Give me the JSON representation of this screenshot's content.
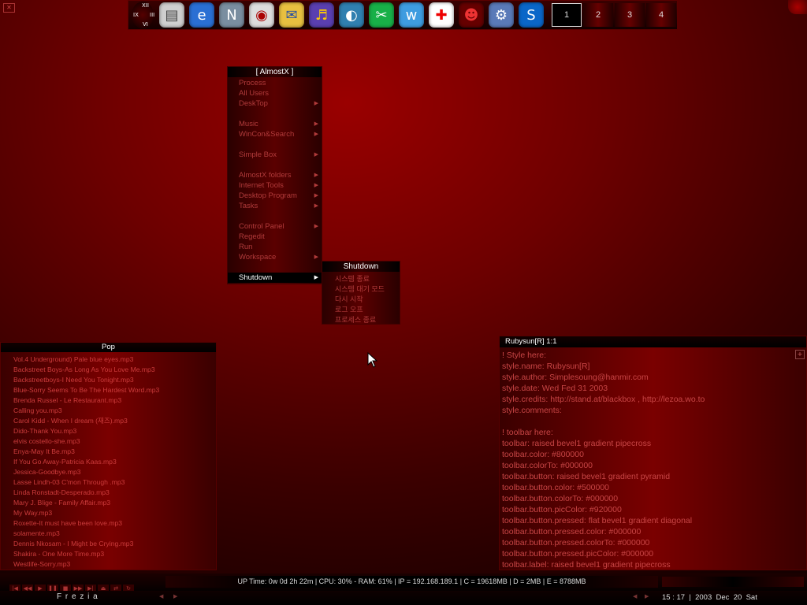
{
  "dock": {
    "clock_numerals": {
      "top": "XII",
      "left": "IX",
      "right": "III",
      "bottom": "VI"
    },
    "icons": [
      {
        "name": "files-icon",
        "glyph": "▤",
        "bg": "#cfcfcf",
        "fg": "#444"
      },
      {
        "name": "internet-explorer-icon",
        "glyph": "e",
        "bg": "#2a6fd3",
        "fg": "#fff"
      },
      {
        "name": "netscape-icon",
        "glyph": "N",
        "bg": "#7a8ea0",
        "fg": "#fff"
      },
      {
        "name": "dvd-icon",
        "glyph": "◉",
        "bg": "#ddd",
        "fg": "#a00"
      },
      {
        "name": "photo-icon",
        "glyph": "✉",
        "bg": "#e8c040",
        "fg": "#2a50a0"
      },
      {
        "name": "media-player-icon",
        "glyph": "♬",
        "bg": "#5a3fb0",
        "fg": "#ffcc00"
      },
      {
        "name": "eye-icon",
        "glyph": "◐",
        "bg": "#3080b0",
        "fg": "#fff"
      },
      {
        "name": "scissors-icon",
        "glyph": "✂",
        "bg": "#18b048",
        "fg": "#fff"
      },
      {
        "name": "word-icon",
        "glyph": "w",
        "bg": "#3e9ce0",
        "fg": "#fff"
      },
      {
        "name": "plus-icon",
        "glyph": "✚",
        "bg": "#fff",
        "fg": "#e00"
      },
      {
        "name": "devil-icon",
        "glyph": "☻",
        "bg": "#600",
        "fg": "#e33"
      },
      {
        "name": "gear-icon",
        "glyph": "⚙",
        "bg": "#5a7ab8",
        "fg": "#fff"
      },
      {
        "name": "swirl-icon",
        "glyph": "S",
        "bg": "#0a66c8",
        "fg": "#fff"
      }
    ],
    "workspaces": [
      "1",
      "2",
      "3",
      "4"
    ]
  },
  "root_menu": {
    "title": "[ AlmostX ]",
    "items": [
      {
        "label": "Process",
        "arrow": false
      },
      {
        "label": "All Users",
        "arrow": false
      },
      {
        "label": "DeskTop",
        "arrow": true
      },
      {
        "sep": true
      },
      {
        "label": "Music",
        "arrow": true
      },
      {
        "label": "WinCon&Search",
        "arrow": true
      },
      {
        "sep": true
      },
      {
        "label": "Simple Box",
        "arrow": true
      },
      {
        "sep": true
      },
      {
        "label": "AlmostX folders",
        "arrow": true
      },
      {
        "label": "Internet Tools",
        "arrow": true
      },
      {
        "label": "Desktop Program",
        "arrow": true
      },
      {
        "label": "Tasks",
        "arrow": true
      },
      {
        "sep": true
      },
      {
        "label": "Control Panel",
        "arrow": true
      },
      {
        "label": "Regedit",
        "arrow": false
      },
      {
        "label": "Run",
        "arrow": false
      },
      {
        "label": "Workspace",
        "arrow": true
      },
      {
        "sep": true
      },
      {
        "label": "Shutdown",
        "arrow": true,
        "highlight": true
      }
    ]
  },
  "shutdown_menu": {
    "title": "Shutdown",
    "items": [
      "시스템 종료",
      "시스템 대기 모드",
      "다시 시작",
      "로그 오프",
      "프로세스 종료"
    ]
  },
  "playlist": {
    "title": "Pop",
    "items": [
      "Vol.4 Underground) Pale blue eyes.mp3",
      "Backstreet Boys-As Long As You Love Me.mp3",
      "Backstreetboys-I Need You Tonight.mp3",
      "Blue-Sorry Seems To Be The Hardest Word.mp3",
      "Brenda Russel - Le Restaurant.mp3",
      "Calling you.mp3",
      "Carol Kidd - When I dream (재즈).mp3",
      "Dido-Thank You.mp3",
      "elvis costello-she.mp3",
      "Enya-May It Be.mp3",
      "If You Go Away-Patricia Kaas.mp3",
      "Jessica-Goodbye.mp3",
      "Lasse Lindh-03 C'mon Through .mp3",
      "Linda Ronstadt-Desperado.mp3",
      "Mary J. Blige - Family Affair.mp3",
      "My Way.mp3",
      "Roxette-It must have been love.mp3",
      "solamente.mp3",
      "Dennis Nkosam - I Might be Crying.mp3",
      "Shakira - One More Time.mp3",
      "Westlife-Sorry.mp3"
    ]
  },
  "style_window": {
    "title": "Rubysun[R]   1:1",
    "lines": [
      "! Style here:",
      "style.name: Rubysun[R]",
      "style.author: Simplesoung@hanmir.com",
      "style.date: Wed Fed 31 2003",
      "style.credits: http://stand.at/blackbox , http://lezoa.wo.to",
      "style.comments: ",
      "",
      "! toolbar here:",
      "toolbar: raised bevel1 gradient pipecross",
      "toolbar.color: #800000",
      "toolbar.colorTo: #000000",
      "toolbar.button: raised bevel1 gradient pyramid",
      "toolbar.button.color: #500000",
      "toolbar.button.colorTo: #000000",
      "toolbar.button.picColor: #920000",
      "toolbar.button.pressed: flat bevel1 gradient diagonal",
      "toolbar.button.pressed.color: #000000",
      "toolbar.button.pressed.colorTo: #000000",
      "toolbar.button.pressed.picColor: #000000",
      "toolbar.label: raised bevel1 gradient pipecross"
    ]
  },
  "status_bar": {
    "sysinfo": "UP Time: 0w 0d 2h 22m   |   CPU: 30% - RAM: 61%   | IP = 192.168.189.1   |   C = 19618MB   |   D = 2MB   |   E = 8788MB"
  },
  "taskbar": {
    "label": "F r e z i a",
    "hour": "15",
    "minute": "17",
    "year": "2003",
    "month": "Dec",
    "day": "20",
    "weekday": "Sat"
  },
  "colors": {
    "accent": "#800000",
    "menu_text": "#b13a3a",
    "code_text": "#c84545"
  }
}
